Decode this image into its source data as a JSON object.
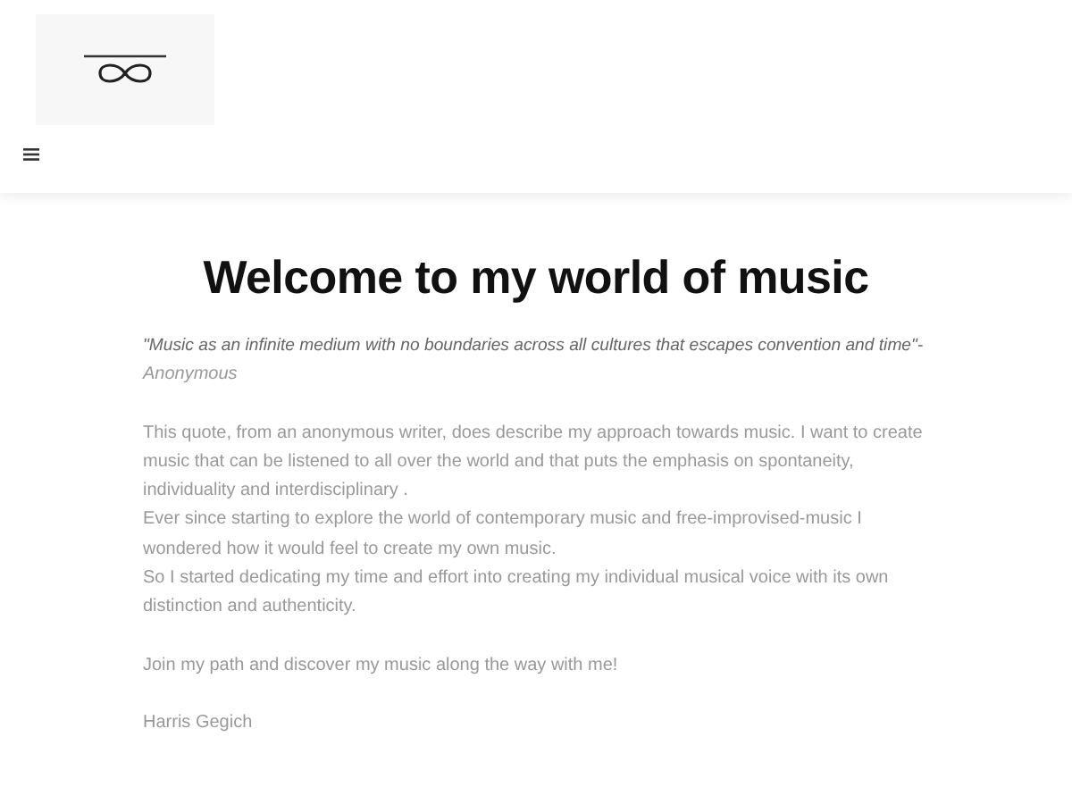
{
  "title": "Welcome to my world of music",
  "quote": {
    "text": "\"Music as an infinite medium with no boundaries across all cultures that escapes convention and time\"-",
    "author": "Anonymous"
  },
  "paragraphs": [
    [
      "This quote, from an anonymous writer, does describe my approach towards music. I want to create music that can be listened to all over the world and that puts the emphasis on spontaneity, individuality and interdisciplinary .",
      "Ever since starting to explore the world of contemporary music and free-improvised-music I wondered how it would feel to create my own music.",
      "So I started dedicating my time and effort into creating my individual musical voice with its own distinction and authenticity."
    ],
    [
      "Join my path and discover my music along the way with me!"
    ],
    [
      "Harris Gegich"
    ]
  ]
}
